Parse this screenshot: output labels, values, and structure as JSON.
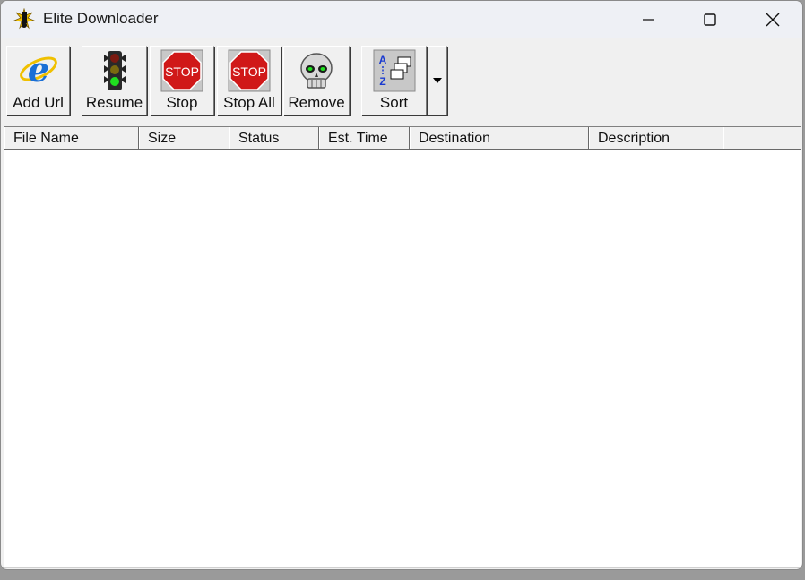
{
  "window": {
    "title": "Elite Downloader"
  },
  "toolbar": {
    "buttons": [
      {
        "label": "Add Url",
        "icon": "internet-explorer-icon"
      },
      {
        "label": "Resume",
        "icon": "traffic-light-icon"
      },
      {
        "label": "Stop",
        "icon": "stop-sign-icon"
      },
      {
        "label": "Stop All",
        "icon": "stop-sign-icon"
      },
      {
        "label": "Remove",
        "icon": "skull-icon"
      },
      {
        "label": "Sort",
        "icon": "sort-az-icon"
      }
    ]
  },
  "list": {
    "columns": [
      "File Name",
      "Size",
      "Status",
      "Est. Time",
      "Destination",
      "Description",
      ""
    ],
    "rows": []
  },
  "colors": {
    "accent_blue": "#1a6fd6",
    "stop_red": "#d01818"
  }
}
